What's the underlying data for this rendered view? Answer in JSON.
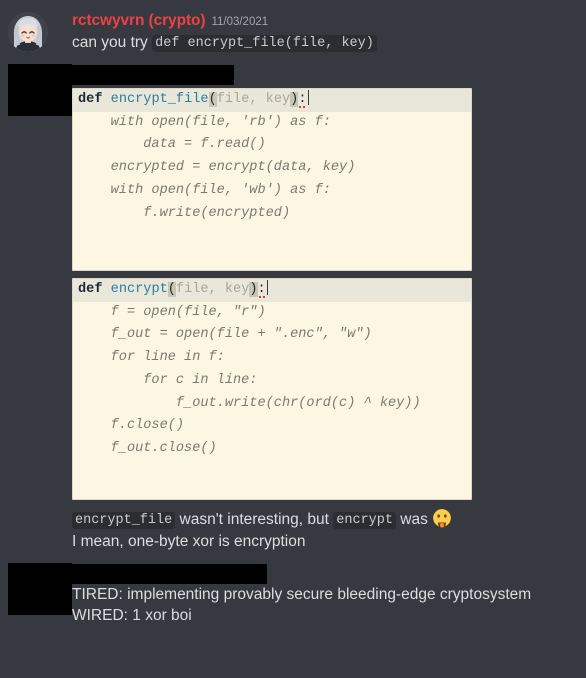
{
  "theme": {
    "app_background": "#36393f",
    "username_color": "#ed4245",
    "text_color": "#dcddde",
    "timestamp_color": "#a3a6aa",
    "inline_code_background": "#2b2d31",
    "code_paper": "#fdf6e3",
    "code_head_highlight": "#e9e6da",
    "code_keyword": "#1b2b34",
    "code_function": "#2a7f9e",
    "code_param": "#a9a698",
    "redaction": "#000000"
  },
  "messages": [
    {
      "id": "msg-crypto",
      "avatar": "anime-girl-avatar",
      "username": "rctcwyvrn (crypto)",
      "timestamp": "11/03/2021",
      "text_before_code": "can you try ",
      "inline_code": "def encrypt_file(file, key)"
    },
    {
      "id": "msg-redacted-code",
      "avatar": "redacted-avatar",
      "username_redacted": true,
      "attachments": [
        {
          "name": "code-screenshot-encrypt-file",
          "lines": [
            {
              "type": "signature",
              "keyword": "def",
              "fn_name": "encrypt_file",
              "open_paren": "(",
              "params": "file, key",
              "close_paren": ")",
              "colon": ":",
              "has_caret": true,
              "has_error_squiggle": true
            },
            {
              "type": "body",
              "text": "    with open(file, 'rb') as f:"
            },
            {
              "type": "body",
              "text": "        data = f.read()"
            },
            {
              "type": "body",
              "text": "    encrypted = encrypt(data, key)"
            },
            {
              "type": "body",
              "text": "    with open(file, 'wb') as f:"
            },
            {
              "type": "body",
              "text": "        f.write(encrypted)"
            },
            {
              "type": "body",
              "text": ""
            },
            {
              "type": "body",
              "text": ""
            }
          ]
        },
        {
          "name": "code-screenshot-encrypt",
          "lines": [
            {
              "type": "signature",
              "keyword": "def",
              "fn_name": "encrypt",
              "open_paren": "(",
              "params": "file, key",
              "close_paren": ")",
              "colon": ":",
              "has_caret": true,
              "has_error_squiggle": true
            },
            {
              "type": "body",
              "text": "    f = open(file, \"r\")"
            },
            {
              "type": "body",
              "text": "    f_out = open(file + \".enc\", \"w\")"
            },
            {
              "type": "body",
              "text": "    for line in f:"
            },
            {
              "type": "body",
              "text": "        for c in line:"
            },
            {
              "type": "body",
              "text": "            f_out.write(chr(ord(c) ^ key))"
            },
            {
              "type": "body",
              "text": "    f.close()"
            },
            {
              "type": "body",
              "text": "    f_out.close()"
            },
            {
              "type": "body",
              "text": ""
            },
            {
              "type": "body",
              "text": ""
            }
          ]
        }
      ],
      "followups": [
        {
          "name": "message-encrypt-file-comment",
          "code_a": "encrypt_file",
          "mid": " wasn't interesting, but ",
          "code_b": "encrypt",
          "tail": " was ",
          "emoji": "face-with-tongue"
        },
        {
          "name": "message-one-byte-xor",
          "text": "I mean, one-byte xor is encryption"
        }
      ]
    },
    {
      "id": "msg-redacted-tired-wired",
      "avatar": "redacted-avatar",
      "username_redacted": true,
      "lines": [
        "TIRED: implementing provably secure bleeding-edge cryptosystem",
        "WIRED: 1 xor boi"
      ]
    }
  ]
}
